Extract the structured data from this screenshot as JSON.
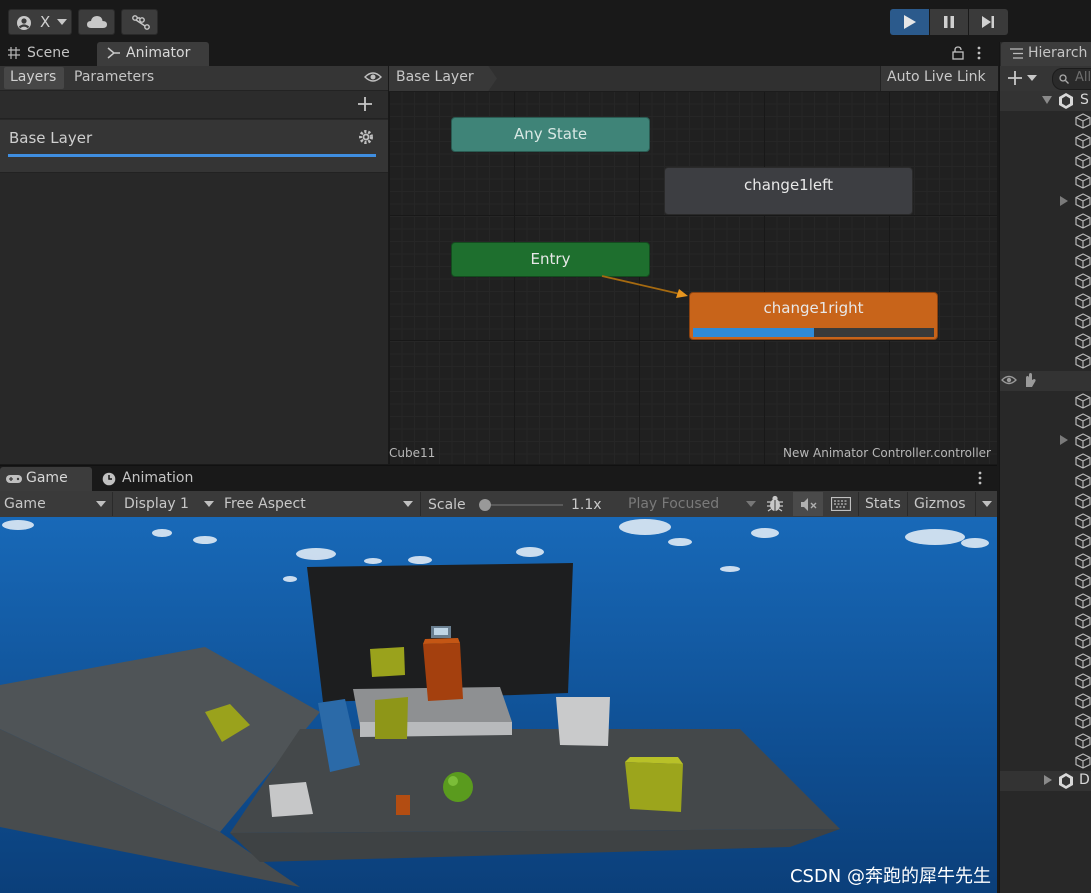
{
  "toolbar": {
    "account_label": "X",
    "play_icon": "play-icon",
    "pause_icon": "pause-icon",
    "step_icon": "step-icon"
  },
  "tabs": {
    "scene": "Scene",
    "animator": "Animator",
    "hierarchy": "Hierarch",
    "game": "Game",
    "animation": "Animation"
  },
  "animator": {
    "layers_tab": "Layers",
    "parameters_tab": "Parameters",
    "layer_name": "Base Layer",
    "breadcrumb": "Base Layer",
    "auto_live_link": "Auto Live Link",
    "status_object": "Cube11",
    "status_controller": "New Animator Controller.controller",
    "playback_progress": 0.5,
    "states": {
      "any_state": "Any State",
      "change1left": "change1left",
      "entry": "Entry",
      "change1right": "change1right"
    }
  },
  "hierarchy": {
    "search_placeholder": "All",
    "scene_root": "S",
    "second_root": "D"
  },
  "game": {
    "view_select": "Game",
    "display_select": "Display 1",
    "aspect_select": "Free Aspect",
    "scale_label": "Scale",
    "scale_value": "1.1x",
    "play_focused": "Play Focused",
    "stats": "Stats",
    "gizmos": "Gizmos"
  },
  "watermark": "CSDN @奔跑的犀牛先生",
  "colors": {
    "any_state": "#3f8478",
    "entry": "#1e6f2e",
    "default_state": "#3d3e42",
    "active_state": "#c8641a",
    "progress": "#2f8ad6",
    "play_active": "#2b5a8c",
    "sky": "#1a66b0"
  }
}
